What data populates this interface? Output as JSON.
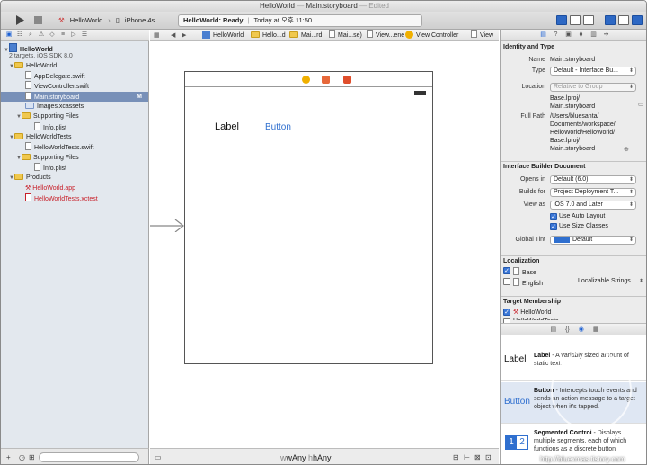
{
  "titlebar": {
    "project": "HelloWorld",
    "separator": "—",
    "file": "Main.storyboard",
    "status": "— Edited"
  },
  "toolbar": {
    "run_icon": "play-icon",
    "stop_icon": "stop-icon",
    "scheme": "HelloWorld",
    "destination": "iPhone 4s",
    "activity_title": "HelloWorld: Ready",
    "activity_sep": "|",
    "activity_time": "Today at 오후 11:50"
  },
  "navigator": {
    "tree": [
      {
        "label": "HelloWorld",
        "kind": "project",
        "bold": true
      },
      {
        "label": "2 targets, iOS SDK 8.0",
        "kind": "subtitle"
      },
      {
        "label": "HelloWorld",
        "kind": "folder"
      },
      {
        "label": "AppDelegate.swift",
        "kind": "file"
      },
      {
        "label": "ViewController.swift",
        "kind": "file"
      },
      {
        "label": "Main.storyboard",
        "kind": "file",
        "selected": true,
        "badge": "M"
      },
      {
        "label": "Images.xcassets",
        "kind": "folder"
      },
      {
        "label": "Supporting Files",
        "kind": "folder"
      },
      {
        "label": "Info.plist",
        "kind": "file"
      },
      {
        "label": "HelloWorldTests",
        "kind": "folder"
      },
      {
        "label": "HelloWorldTests.swift",
        "kind": "file"
      },
      {
        "label": "Supporting Files",
        "kind": "folder"
      },
      {
        "label": "Info.plist",
        "kind": "file"
      },
      {
        "label": "Products",
        "kind": "folder"
      },
      {
        "label": "HelloWorld.app",
        "kind": "app"
      },
      {
        "label": "HelloWorldTests.xctest",
        "kind": "app"
      }
    ],
    "footer": {
      "add": "+"
    }
  },
  "jumpbar": {
    "crumbs": [
      "HelloWorld",
      "Hello...d",
      "Mai...rd",
      "Mai...se)",
      "View...ene",
      "View Controller",
      "View"
    ]
  },
  "canvas": {
    "label_text": "Label",
    "button_text": "Button",
    "size_class_w": "wAny",
    "size_class_h": "hAny",
    "size_class_w_prefix": "w",
    "size_class_h_prefix": "h"
  },
  "inspector": {
    "identity": {
      "title": "Identity and Type",
      "name_key": "Name",
      "name_val": "Main.storyboard",
      "type_key": "Type",
      "type_val": "Default - Interface Bu...",
      "location_key": "Location",
      "location_val": "Relative to Group",
      "location_path": [
        "Base.lproj/",
        "Main.storyboard"
      ],
      "fullpath_key": "Full Path",
      "fullpath_val": [
        "/Users/bluesanta/",
        "Documents/workspace/",
        "HelloWorld/HelloWorld/",
        "Base.lproj/",
        "Main.storyboard"
      ]
    },
    "ibdoc": {
      "title": "Interface Builder Document",
      "opens_key": "Opens in",
      "opens_val": "Default (6.0)",
      "builds_key": "Builds for",
      "builds_val": "Project Deployment T...",
      "viewas_key": "View as",
      "viewas_val": "iOS 7.0 and Later",
      "autolayout": "Use Auto Layout",
      "sizeclasses": "Use Size Classes",
      "tint_key": "Global Tint",
      "tint_val": "Default"
    },
    "localization": {
      "title": "Localization",
      "base": "Base",
      "english": "English",
      "english_val": "Localizable Strings"
    },
    "membership": {
      "title": "Target Membership",
      "target1": "HelloWorld",
      "target2": "HelloWorldTests"
    }
  },
  "library": {
    "items": [
      {
        "icon_text": "Label",
        "name": "Label",
        "desc": " - A variably sized amount of static text."
      },
      {
        "icon_text": "Button",
        "name": "Button",
        "desc": " - Intercepts touch events and sends an action message to a target object when it's tapped."
      },
      {
        "icon_text": [
          "1",
          "2"
        ],
        "name": "Segmented Control",
        "desc": " - Displays multiple segments, each of which functions as a discrete button"
      }
    ]
  },
  "watermark": {
    "url": "http://bluexmas.tistory.com"
  },
  "colors": {
    "accent": "#2d68c4",
    "selection": "#7890b8",
    "button_blue": "#2f6fcf",
    "error_red": "#c8202a"
  }
}
